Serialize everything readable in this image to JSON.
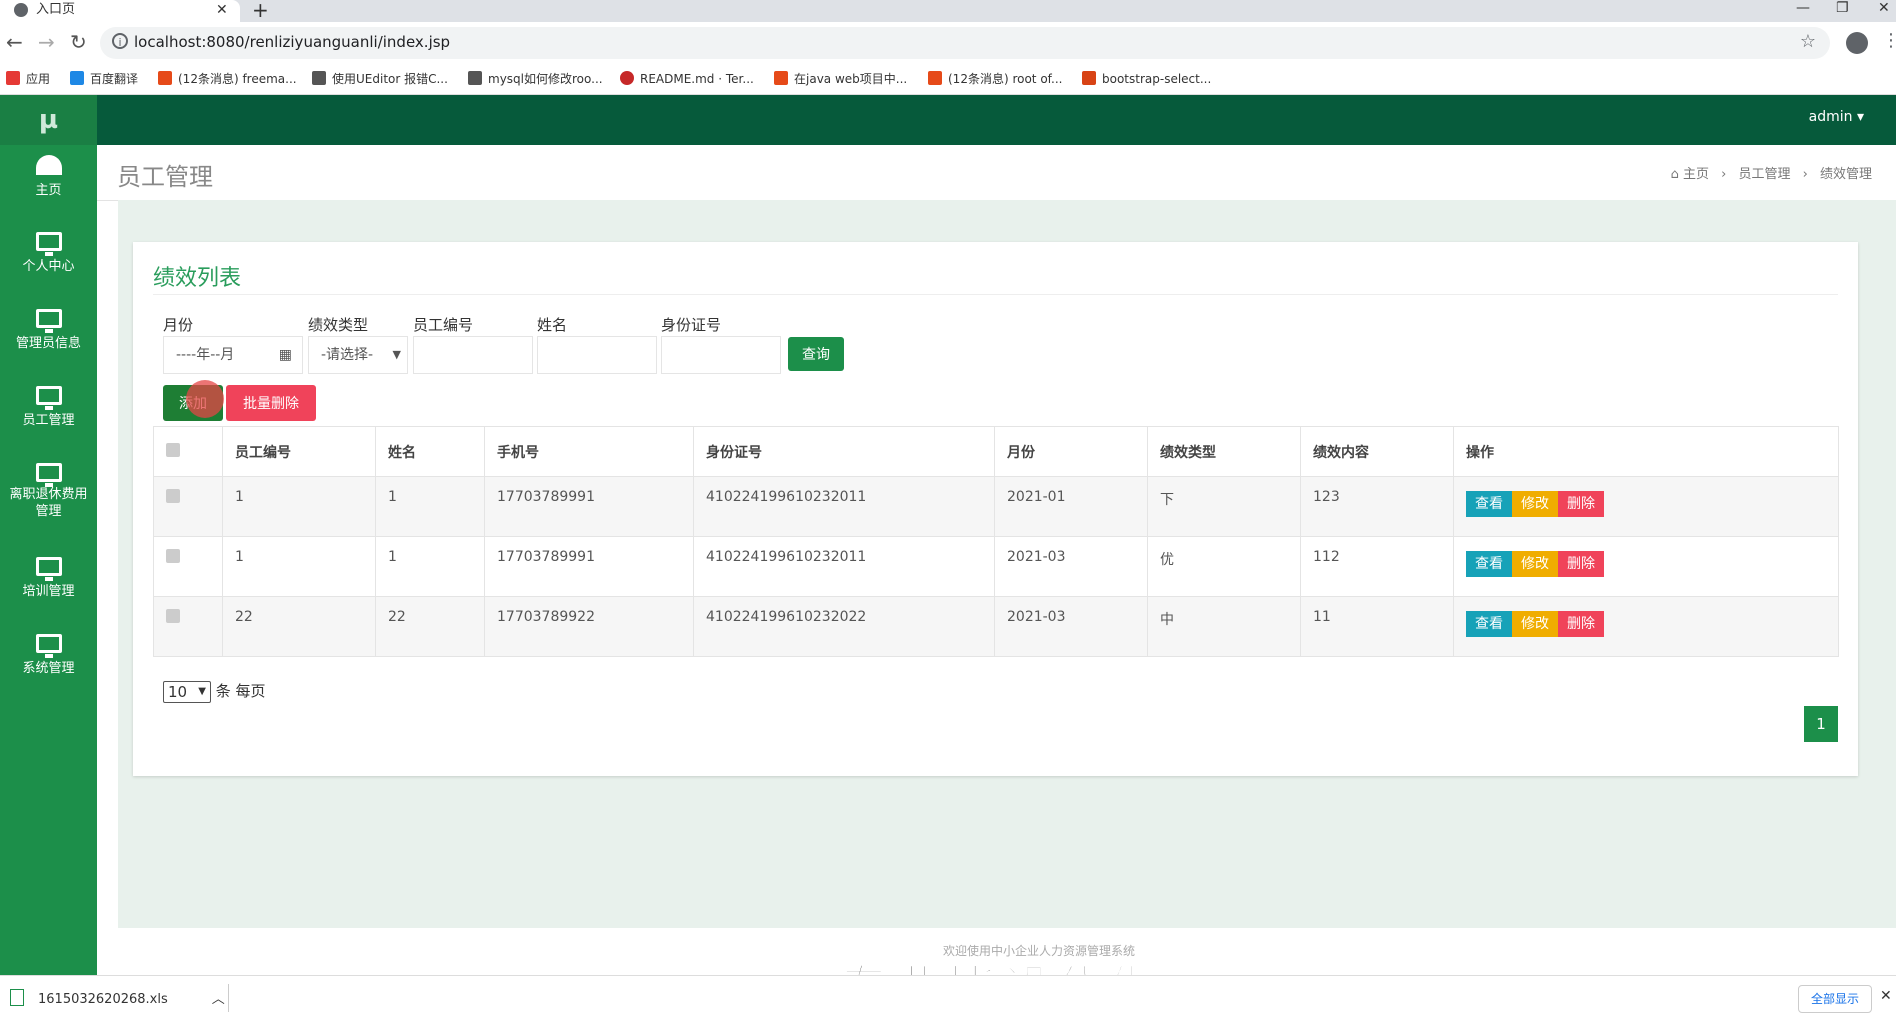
{
  "browser": {
    "tab_title": "入口页",
    "tab_close": "✕",
    "new_tab": "+",
    "url": "localhost:8080/renliziyuanguanli/index.jsp",
    "controls": {
      "minimize": "—",
      "restore": "❐",
      "close": "✕"
    },
    "bookmarks": [
      {
        "label": "应用",
        "color": "#e53935"
      },
      {
        "label": "百度翻译",
        "color": "#1e88e5"
      },
      {
        "label": "(12条消息) freema...",
        "color": "#e64a19"
      },
      {
        "label": "使用UEditor 报错C...",
        "color": "#555555"
      },
      {
        "label": "mysql如何修改roo...",
        "color": "#555555"
      },
      {
        "label": "README.md · Ter...",
        "color": "#c62828"
      },
      {
        "label": "在java web项目中...",
        "color": "#e64a19"
      },
      {
        "label": "(12条消息) root of...",
        "color": "#e64a19"
      },
      {
        "label": "bootstrap-select...",
        "color": "#d84315"
      }
    ]
  },
  "app": {
    "logo": "µ",
    "user": "admin ▾",
    "page_title": "员工管理",
    "breadcrumb": [
      "⌂ 主页",
      "›",
      "员工管理",
      "›",
      "绩效管理"
    ]
  },
  "sidebar": {
    "items": [
      {
        "label": "主页",
        "icon": "dashboard-icon"
      },
      {
        "label": "个人中心",
        "icon": "monitor-icon"
      },
      {
        "label": "管理员信息",
        "icon": "monitor-icon"
      },
      {
        "label": "员工管理",
        "icon": "monitor-icon"
      },
      {
        "label": "离职退休费用管理",
        "icon": "monitor-icon"
      },
      {
        "label": "培训管理",
        "icon": "monitor-icon"
      },
      {
        "label": "系统管理",
        "icon": "monitor-icon"
      }
    ]
  },
  "filters": {
    "title": "绩效列表",
    "month_label": "月份",
    "month_value": "----年--月",
    "type_label": "绩效类型",
    "type_value": "-请选择-",
    "empno_label": "员工编号",
    "name_label": "姓名",
    "id_label": "身份证号",
    "query_button": "查询",
    "add_button": "添加",
    "batch_delete_button": "批量删除"
  },
  "table": {
    "headers": [
      "员工编号",
      "姓名",
      "手机号",
      "身份证号",
      "月份",
      "绩效类型",
      "绩效内容",
      "操作"
    ],
    "rows": [
      [
        "1",
        "1",
        "17703789991",
        "410224199610232011",
        "2021-01",
        "下",
        "123"
      ],
      [
        "1",
        "1",
        "17703789991",
        "410224199610232011",
        "2021-03",
        "优",
        "112"
      ],
      [
        "22",
        "22",
        "17703789922",
        "410224199610232022",
        "2021-03",
        "中",
        "11"
      ]
    ],
    "actions": {
      "view": "查看",
      "edit": "修改",
      "delete": "删除"
    }
  },
  "pagination": {
    "page_size": "10",
    "page_size_suffix": "条 每页",
    "current_page": "1"
  },
  "footer": {
    "text": "欢迎使用中小企业人力资源管理系统",
    "overlay": "专业毕设代做"
  },
  "downloads": {
    "file": "1615032620268.xls",
    "show_all": "全部显示",
    "close": "✕"
  },
  "colors": {
    "sidebar": "#1c8f4a",
    "topbar": "#065a3b",
    "view": "#17a2b8",
    "edit": "#f0ad00",
    "delete": "#f0435a",
    "add": "#1e7e34",
    "query": "#1c8f4a"
  }
}
